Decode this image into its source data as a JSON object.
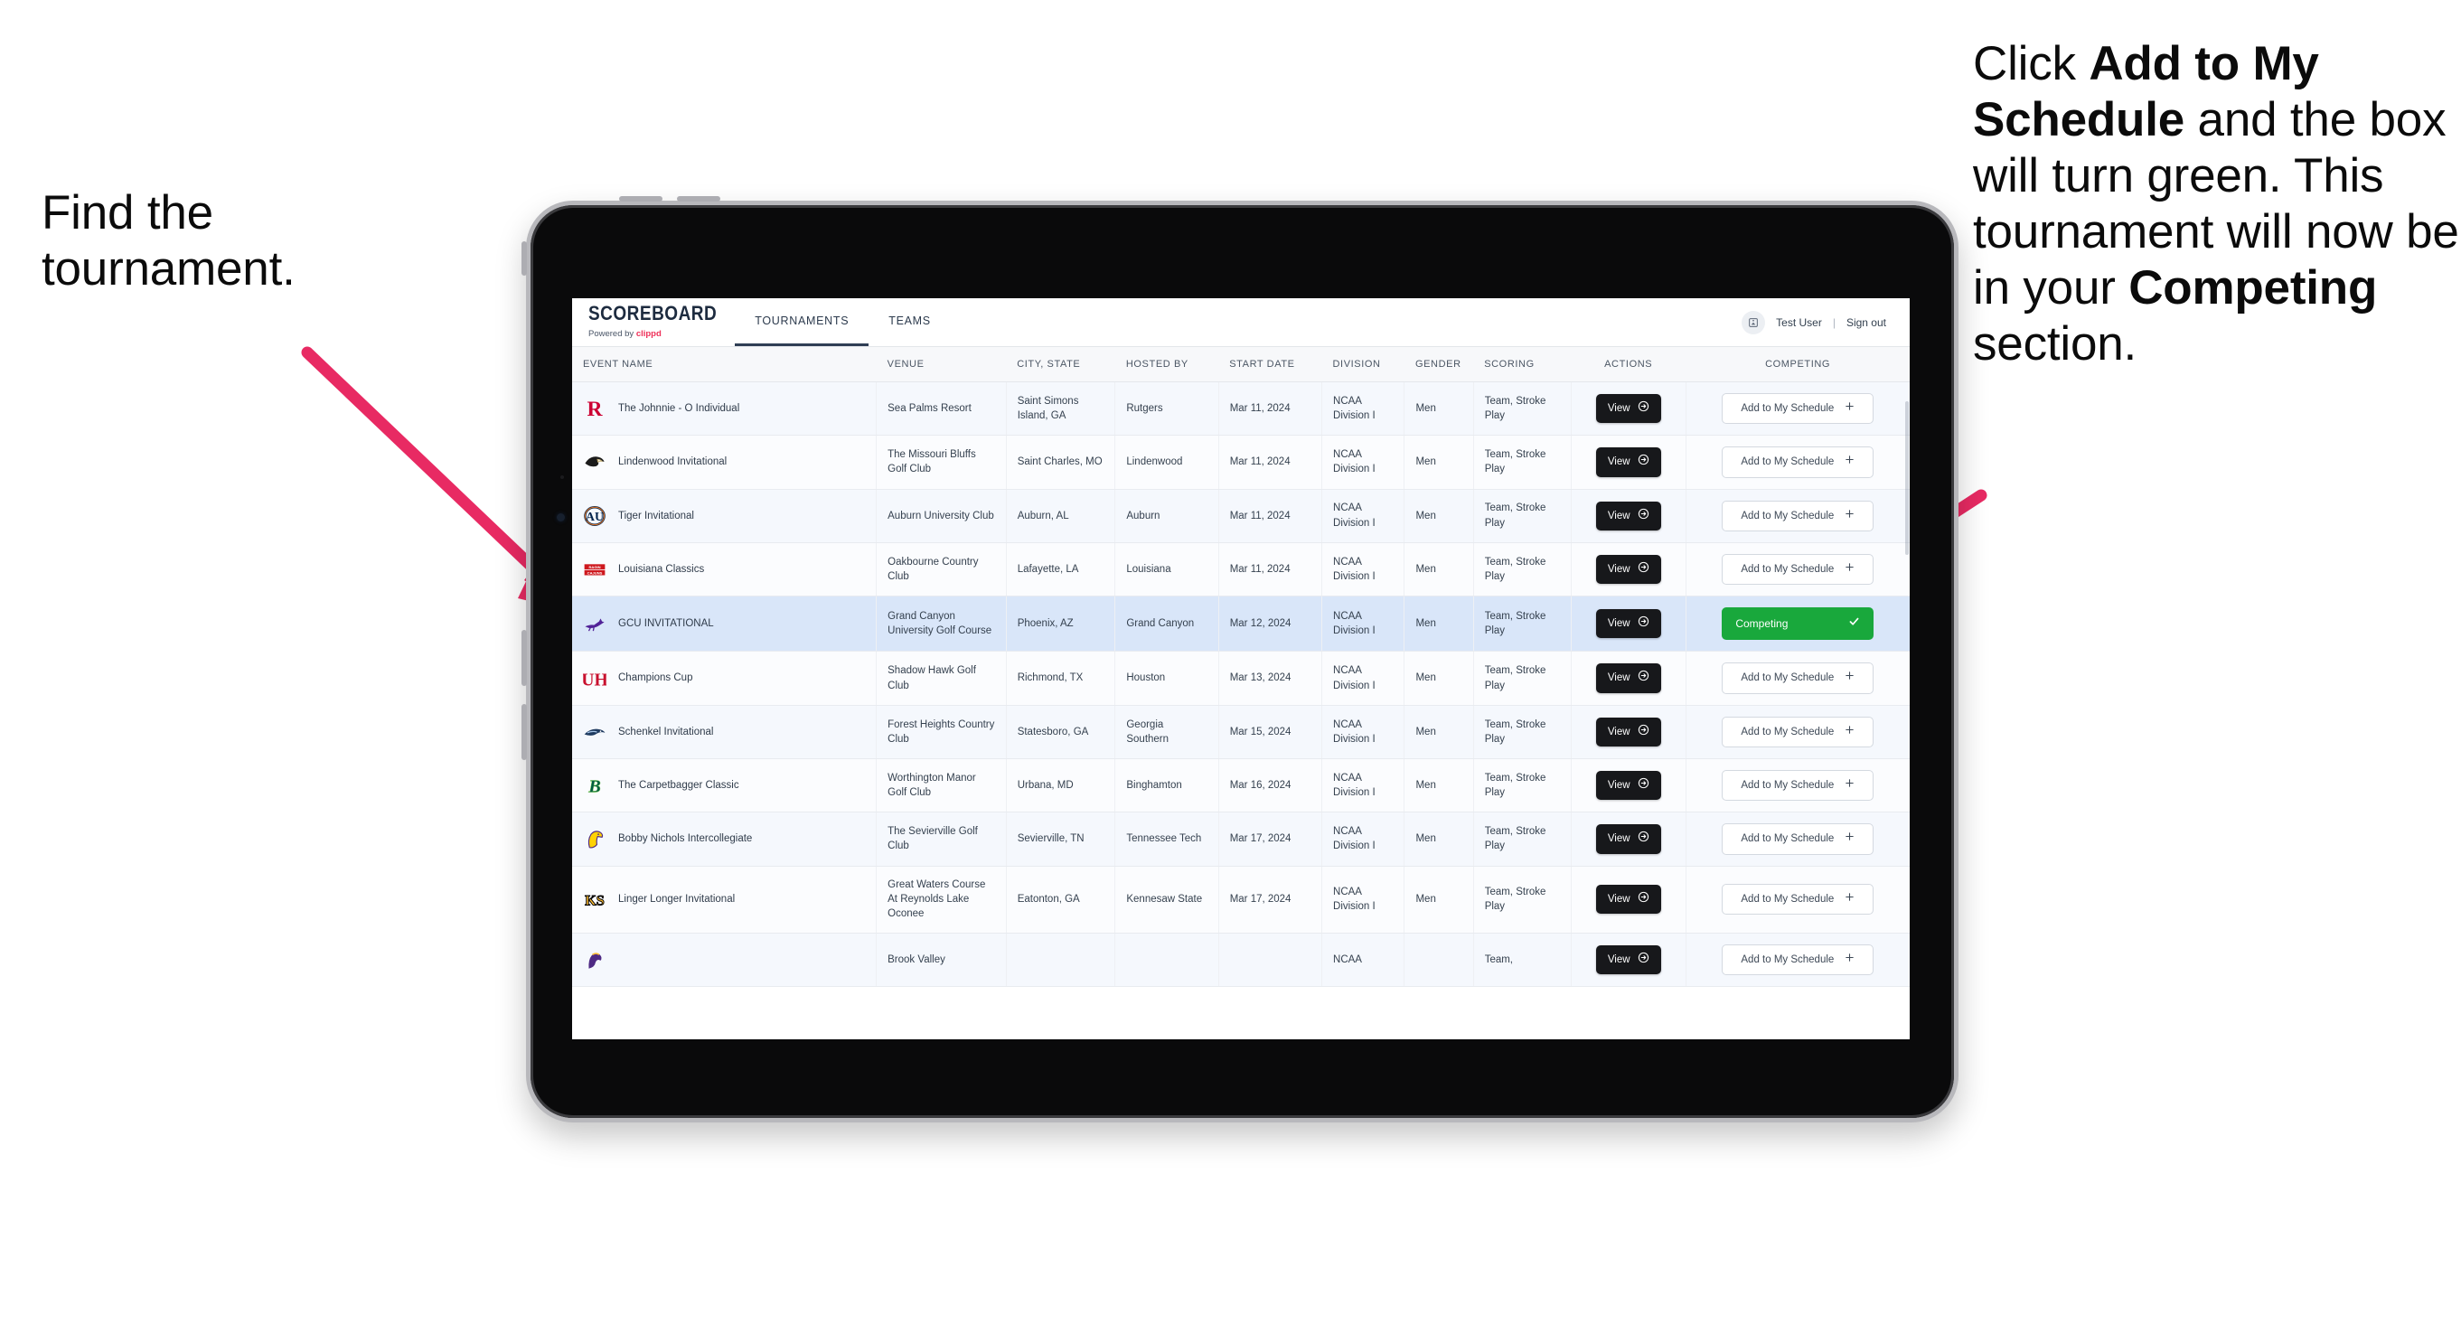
{
  "annotations": {
    "left": {
      "line1": "Find the",
      "line2": "tournament."
    },
    "right": {
      "p1_a": "Click ",
      "p1_b": "Add to My Schedule",
      "p1_c": " and the box will turn green. This tournament will now be in your ",
      "p1_d": "Competing",
      "p1_e": " section."
    },
    "arrow_color": "#E82A63"
  },
  "app": {
    "brand": {
      "title": "SCOREBOARD",
      "powered_prefix": "Powered by ",
      "powered_brand": "clippd"
    },
    "nav": [
      {
        "label": "TOURNAMENTS",
        "active": true
      },
      {
        "label": "TEAMS",
        "active": false
      }
    ],
    "account": {
      "avatar_icon": "user-badge-icon",
      "user": "Test User",
      "separator": "|",
      "sign_out": "Sign out"
    },
    "table": {
      "columns": [
        "EVENT NAME",
        "VENUE",
        "CITY, STATE",
        "HOSTED BY",
        "START DATE",
        "DIVISION",
        "GENDER",
        "SCORING",
        "ACTIONS",
        "COMPETING"
      ],
      "view_label": "View",
      "add_label": "Add to My Schedule",
      "add_icon": "plus-icon",
      "competing_label": "Competing",
      "competing_icon": "check-icon",
      "competing_color": "#19A83C",
      "rows": [
        {
          "logo": "rutgers-r-logo",
          "event": "The Johnnie - O Individual",
          "venue": "Sea Palms Resort",
          "city": "Saint Simons Island, GA",
          "host": "Rutgers",
          "date": "Mar 11, 2024",
          "division": "NCAA Division I",
          "gender": "Men",
          "scoring": "Team, Stroke Play",
          "competing": false
        },
        {
          "logo": "lindenwood-lion-logo",
          "event": "Lindenwood Invitational",
          "venue": "The Missouri Bluffs Golf Club",
          "city": "Saint Charles, MO",
          "host": "Lindenwood",
          "date": "Mar 11, 2024",
          "division": "NCAA Division I",
          "gender": "Men",
          "scoring": "Team, Stroke Play",
          "competing": false
        },
        {
          "logo": "auburn-au-logo",
          "event": "Tiger Invitational",
          "venue": "Auburn University Club",
          "city": "Auburn, AL",
          "host": "Auburn",
          "date": "Mar 11, 2024",
          "division": "NCAA Division I",
          "gender": "Men",
          "scoring": "Team, Stroke Play",
          "competing": false
        },
        {
          "logo": "louisiana-ragin-cajuns-logo",
          "event": "Louisiana Classics",
          "venue": "Oakbourne Country Club",
          "city": "Lafayette, LA",
          "host": "Louisiana",
          "date": "Mar 11, 2024",
          "division": "NCAA Division I",
          "gender": "Men",
          "scoring": "Team, Stroke Play",
          "competing": false
        },
        {
          "logo": "gcu-lope-logo",
          "event": "GCU INVITATIONAL",
          "venue": "Grand Canyon University Golf Course",
          "city": "Phoenix, AZ",
          "host": "Grand Canyon",
          "date": "Mar 12, 2024",
          "division": "NCAA Division I",
          "gender": "Men",
          "scoring": "Team, Stroke Play",
          "competing": true
        },
        {
          "logo": "houston-uh-logo",
          "event": "Champions Cup",
          "venue": "Shadow Hawk Golf Club",
          "city": "Richmond, TX",
          "host": "Houston",
          "date": "Mar 13, 2024",
          "division": "NCAA Division I",
          "gender": "Men",
          "scoring": "Team, Stroke Play",
          "competing": false
        },
        {
          "logo": "georgia-southern-eagle-logo",
          "event": "Schenkel Invitational",
          "venue": "Forest Heights Country Club",
          "city": "Statesboro, GA",
          "host": "Georgia Southern",
          "date": "Mar 15, 2024",
          "division": "NCAA Division I",
          "gender": "Men",
          "scoring": "Team, Stroke Play",
          "competing": false
        },
        {
          "logo": "binghamton-b-logo",
          "event": "The Carpetbagger Classic",
          "venue": "Worthington Manor Golf Club",
          "city": "Urbana, MD",
          "host": "Binghamton",
          "date": "Mar 16, 2024",
          "division": "NCAA Division I",
          "gender": "Men",
          "scoring": "Team, Stroke Play",
          "competing": false
        },
        {
          "logo": "tennessee-tech-eagle-logo",
          "event": "Bobby Nichols Intercollegiate",
          "venue": "The Sevierville Golf Club",
          "city": "Sevierville, TN",
          "host": "Tennessee Tech",
          "date": "Mar 17, 2024",
          "division": "NCAA Division I",
          "gender": "Men",
          "scoring": "Team, Stroke Play",
          "competing": false
        },
        {
          "logo": "kennesaw-state-ks-logo",
          "event": "Linger Longer Invitational",
          "venue": "Great Waters Course At Reynolds Lake Oconee",
          "city": "Eatonton, GA",
          "host": "Kennesaw State",
          "date": "Mar 17, 2024",
          "division": "NCAA Division I",
          "gender": "Men",
          "scoring": "Team, Stroke Play",
          "competing": false
        },
        {
          "logo": "ecu-pirate-logo",
          "event": "",
          "venue": "Brook Valley",
          "city": "",
          "host": "",
          "date": "",
          "division": "NCAA",
          "gender": "",
          "scoring": "Team,",
          "competing": false
        }
      ]
    }
  }
}
